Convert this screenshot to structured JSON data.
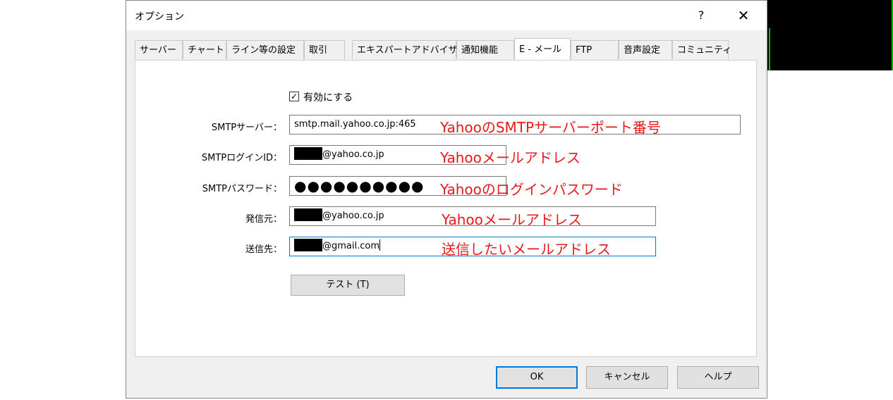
{
  "window": {
    "title": "オプション",
    "help_label": "?",
    "close_label": "✕"
  },
  "tabs": [
    {
      "label": "サーバー"
    },
    {
      "label": "チャート"
    },
    {
      "label": "ライン等の設定"
    },
    {
      "label": "取引"
    },
    {
      "label": "エキスパートアドバイザ"
    },
    {
      "label": "通知機能"
    },
    {
      "label": "E - メール",
      "active": true
    },
    {
      "label": "FTP"
    },
    {
      "label": "音声設定"
    },
    {
      "label": "コミュニティ"
    }
  ],
  "email": {
    "enable_label": "有効にする",
    "enable_checked": true,
    "check_mark": "✓",
    "smtp_server_label": "SMTPサーバー：",
    "smtp_server_value": "smtp.mail.yahoo.co.jp:465",
    "smtp_login_label": "SMTPログインID：",
    "smtp_login_value": "@yahoo.co.jp",
    "smtp_password_label": "SMTPパスワード：",
    "smtp_password_value": "●●●●●●●●●●",
    "from_label": "発信元：",
    "from_value": "@yahoo.co.jp",
    "to_label": "送信先：",
    "to_value": "@gmail.com",
    "test_button": "テスト (T)"
  },
  "annotations": {
    "server": "YahooのSMTPサーバーポート番号",
    "login": "Yahooメールアドレス",
    "password": "Yahooのログインパスワード",
    "from": "Yahooメールアドレス",
    "to": "送信したいメールアドレス",
    "color": "#e8191d"
  },
  "buttons": {
    "ok": "OK",
    "cancel": "キャンセル",
    "help": "ヘルプ"
  }
}
